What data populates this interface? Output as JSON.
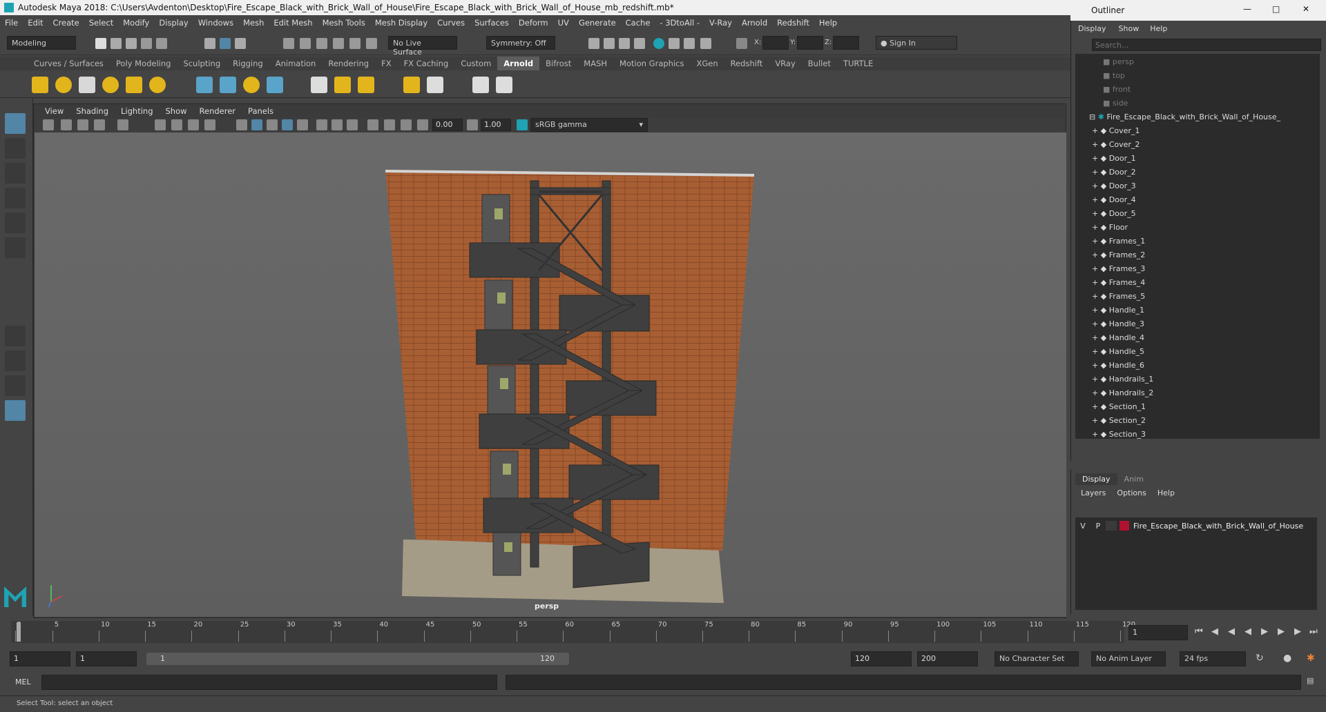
{
  "titlebar": {
    "title": "Autodesk Maya 2018: C:\\Users\\Avdenton\\Desktop\\Fire_Escape_Black_with_Brick_Wall_of_House\\Fire_Escape_Black_with_Brick_Wall_of_House_mb_redshift.mb*"
  },
  "menubar": [
    "File",
    "Edit",
    "Create",
    "Select",
    "Modify",
    "Display",
    "Windows",
    "Mesh",
    "Edit Mesh",
    "Mesh Tools",
    "Mesh Display",
    "Curves",
    "Surfaces",
    "Deform",
    "UV",
    "Generate",
    "Cache",
    "- 3DtoAll -",
    "V-Ray",
    "Arnold",
    "Redshift",
    "Help"
  ],
  "status": {
    "mode": "Modeling",
    "live_surface": "No Live Surface",
    "symmetry": "Symmetry: Off",
    "x_label": "X:",
    "y_label": "Y:",
    "z_label": "Z:",
    "sign_in": "Sign In"
  },
  "shelf_tabs": [
    "Curves / Surfaces",
    "Poly Modeling",
    "Sculpting",
    "Rigging",
    "Animation",
    "Rendering",
    "FX",
    "FX Caching",
    "Custom",
    "Arnold",
    "Bifrost",
    "MASH",
    "Motion Graphics",
    "XGen",
    "Redshift",
    "VRay",
    "Bullet",
    "TURTLE"
  ],
  "shelf_active": "Arnold",
  "viewport": {
    "menu": [
      "View",
      "Shading",
      "Lighting",
      "Show",
      "Renderer",
      "Panels"
    ],
    "exposure": "0.00",
    "gamma": "1.00",
    "color_space": "sRGB gamma",
    "camera_label": "persp"
  },
  "outliner": {
    "title": "Outliner",
    "menu": [
      "Display",
      "Show",
      "Help"
    ],
    "search_placeholder": "Search...",
    "cameras": [
      "persp",
      "top",
      "front",
      "side"
    ],
    "group": "Fire_Escape_Black_with_Brick_Wall_of_House_",
    "children": [
      "Cover_1",
      "Cover_2",
      "Door_1",
      "Door_2",
      "Door_3",
      "Door_4",
      "Door_5",
      "Floor",
      "Frames_1",
      "Frames_2",
      "Frames_3",
      "Frames_4",
      "Frames_5",
      "Handle_1",
      "Handle_3",
      "Handle_4",
      "Handle_5",
      "Handle_6",
      "Handrails_1",
      "Handrails_2",
      "Section_1",
      "Section_2",
      "Section_3"
    ]
  },
  "layers": {
    "tabs": [
      "Display",
      "Anim"
    ],
    "menu": [
      "Layers",
      "Options",
      "Help"
    ],
    "row": {
      "v": "V",
      "p": "P",
      "name": "Fire_Escape_Black_with_Brick_Wall_of_House",
      "color": "#b0122f"
    }
  },
  "timeline": {
    "ticks": [
      1,
      5,
      10,
      15,
      20,
      25,
      30,
      35,
      40,
      45,
      50,
      55,
      60,
      65,
      70,
      75,
      80,
      85,
      90,
      95,
      100,
      105,
      110,
      115,
      120
    ],
    "current_frame": "1"
  },
  "range": {
    "start": "1",
    "inner_start": "1",
    "slider_start": "1",
    "slider_end": "120",
    "end": "120",
    "max": "200",
    "character_set": "No Character Set",
    "anim_layer": "No Anim Layer",
    "fps": "24 fps"
  },
  "cmd": {
    "label": "MEL"
  },
  "help": {
    "text": "Select Tool: select an object"
  }
}
